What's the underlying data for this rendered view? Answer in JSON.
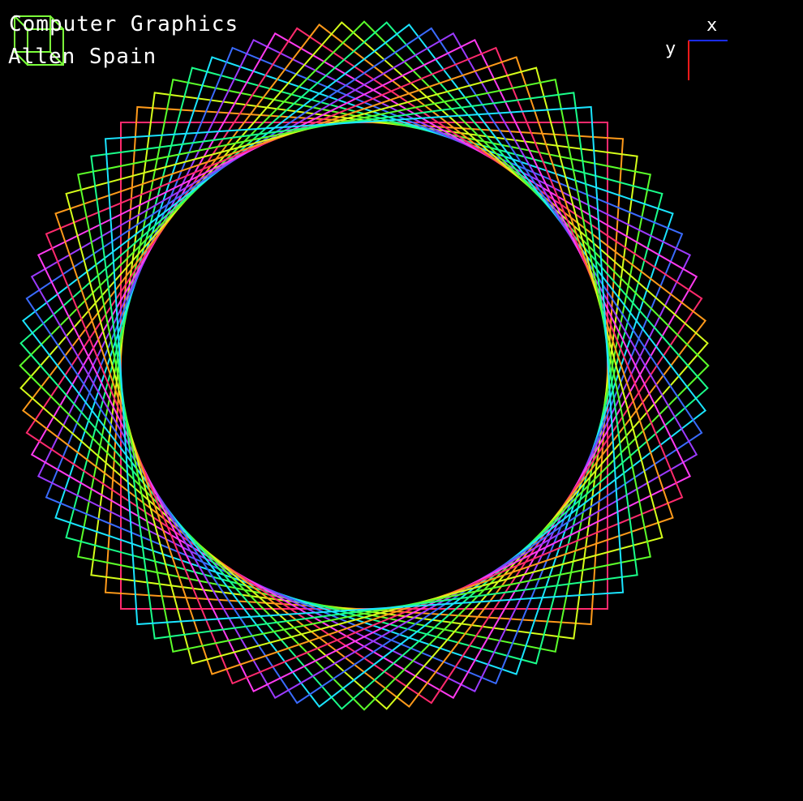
{
  "window": {
    "background": "#000000"
  },
  "overlay": {
    "title": "Computer Graphics",
    "author": "Allen Spain"
  },
  "axis_gizmo": {
    "x_label": "x",
    "y_label": "y",
    "x_color": "#1a2cff",
    "y_color": "#ff1a1a"
  },
  "corner_icon": {
    "name": "cube-wireframe-icon",
    "color": "#7cff3a"
  },
  "spirograph": {
    "shape": "square",
    "square_count": 24,
    "palette": [
      "#ff2a6d",
      "#ff9a1a",
      "#d6ff1a",
      "#5cff2a",
      "#1aff8a",
      "#1ae4ff",
      "#3a6bff",
      "#9b3aff",
      "#ff3af0"
    ]
  }
}
